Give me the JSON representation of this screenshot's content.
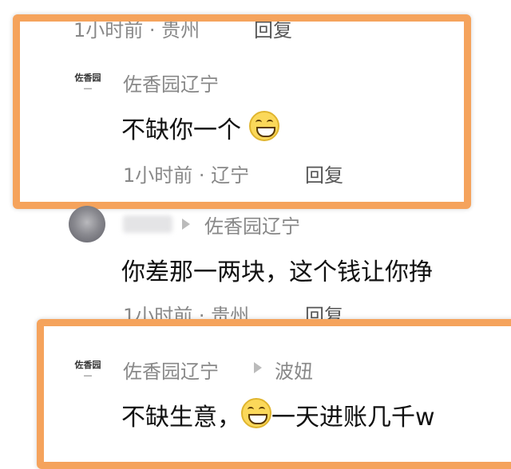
{
  "comments": [
    {
      "meta_time": "1小时前",
      "meta_region": "贵州",
      "reply": "回复"
    },
    {
      "avatar_text": "佐香园",
      "username": "佐香园辽宁",
      "text": "不缺你一个",
      "emoji_icon": "grinning-face-icon",
      "meta_time": "1小时前",
      "meta_region": "辽宁",
      "reply": "回复"
    },
    {
      "reply_to": "佐香园辽宁",
      "text": "你差那一两块，这个钱让你挣",
      "meta_time": "1小时前",
      "meta_region": "贵州",
      "reply": "回复"
    },
    {
      "avatar_text": "佐香园",
      "username": "佐香园辽宁",
      "reply_to": "波妞",
      "text_before": "不缺生意，",
      "emoji_icon": "grinning-face-icon",
      "text_after": "一天进账几千w"
    }
  ],
  "colors": {
    "highlight_frame": "#f5a35c",
    "meta_text": "#888888"
  }
}
